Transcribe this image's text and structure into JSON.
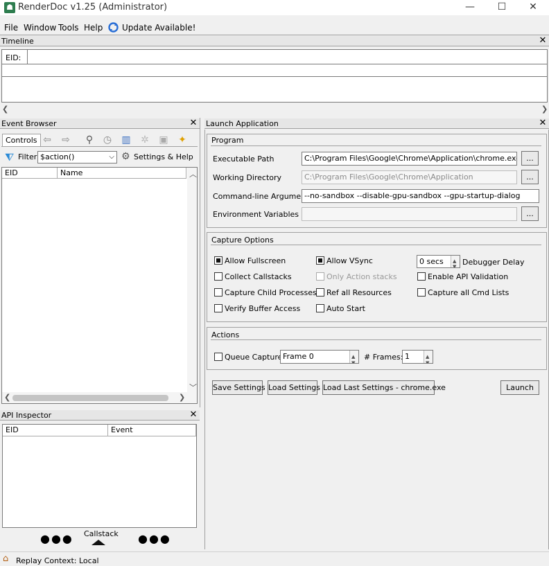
{
  "window": {
    "title": "RenderDoc v1.25 (Administrator)",
    "minimize": "—",
    "maximize": "☐",
    "close": "✕"
  },
  "menu": {
    "items": [
      "File",
      "Window",
      "Tools",
      "Help"
    ],
    "update": "Update Available!"
  },
  "timeline": {
    "title": "Timeline",
    "eid_label": "EID:"
  },
  "event_browser": {
    "title": "Event Browser",
    "controls_label": "Controls",
    "filter_label": "Filter",
    "filter_value": "$action()",
    "settings_help": "Settings & Help",
    "columns": [
      "EID",
      "Name"
    ]
  },
  "api_inspector": {
    "title": "API Inspector",
    "columns": [
      "EID",
      "Event"
    ],
    "callstack": "Callstack"
  },
  "launch": {
    "title": "Launch Application",
    "program": {
      "title": "Program",
      "exe_label": "Executable Path",
      "exe_value": "C:\\Program Files\\Google\\Chrome\\Application\\chrome.exe",
      "wd_label": "Working Directory",
      "wd_placeholder": "C:\\Program Files\\Google\\Chrome\\Application",
      "args_label": "Command-line Arguments",
      "args_value": "--no-sandbox --disable-gpu-sandbox --gpu-startup-dialog",
      "env_label": "Environment Variables",
      "browse": "..."
    },
    "capture": {
      "title": "Capture Options",
      "allow_fullscreen": "Allow Fullscreen",
      "allow_vsync": "Allow VSync",
      "debugger_delay_value": "0 secs",
      "debugger_delay_label": "Debugger Delay",
      "collect_callstacks": "Collect Callstacks",
      "only_action_stacks": "Only Action stacks",
      "enable_api_validation": "Enable API Validation",
      "capture_child": "Capture Child Processes",
      "ref_all": "Ref all Resources",
      "capture_all_cmd": "Capture all Cmd Lists",
      "verify_buffer": "Verify Buffer Access",
      "auto_start": "Auto Start"
    },
    "actions": {
      "title": "Actions",
      "queue_capture": "Queue Capture",
      "frame_value": "Frame 0",
      "frames_label": "# Frames:",
      "frames_value": "1"
    },
    "buttons": {
      "save": "Save Settings",
      "load": "Load Settings",
      "load_last": "Load Last Settings - chrome.exe",
      "launch": "Launch"
    }
  },
  "status": {
    "text": "Replay Context: Local"
  }
}
